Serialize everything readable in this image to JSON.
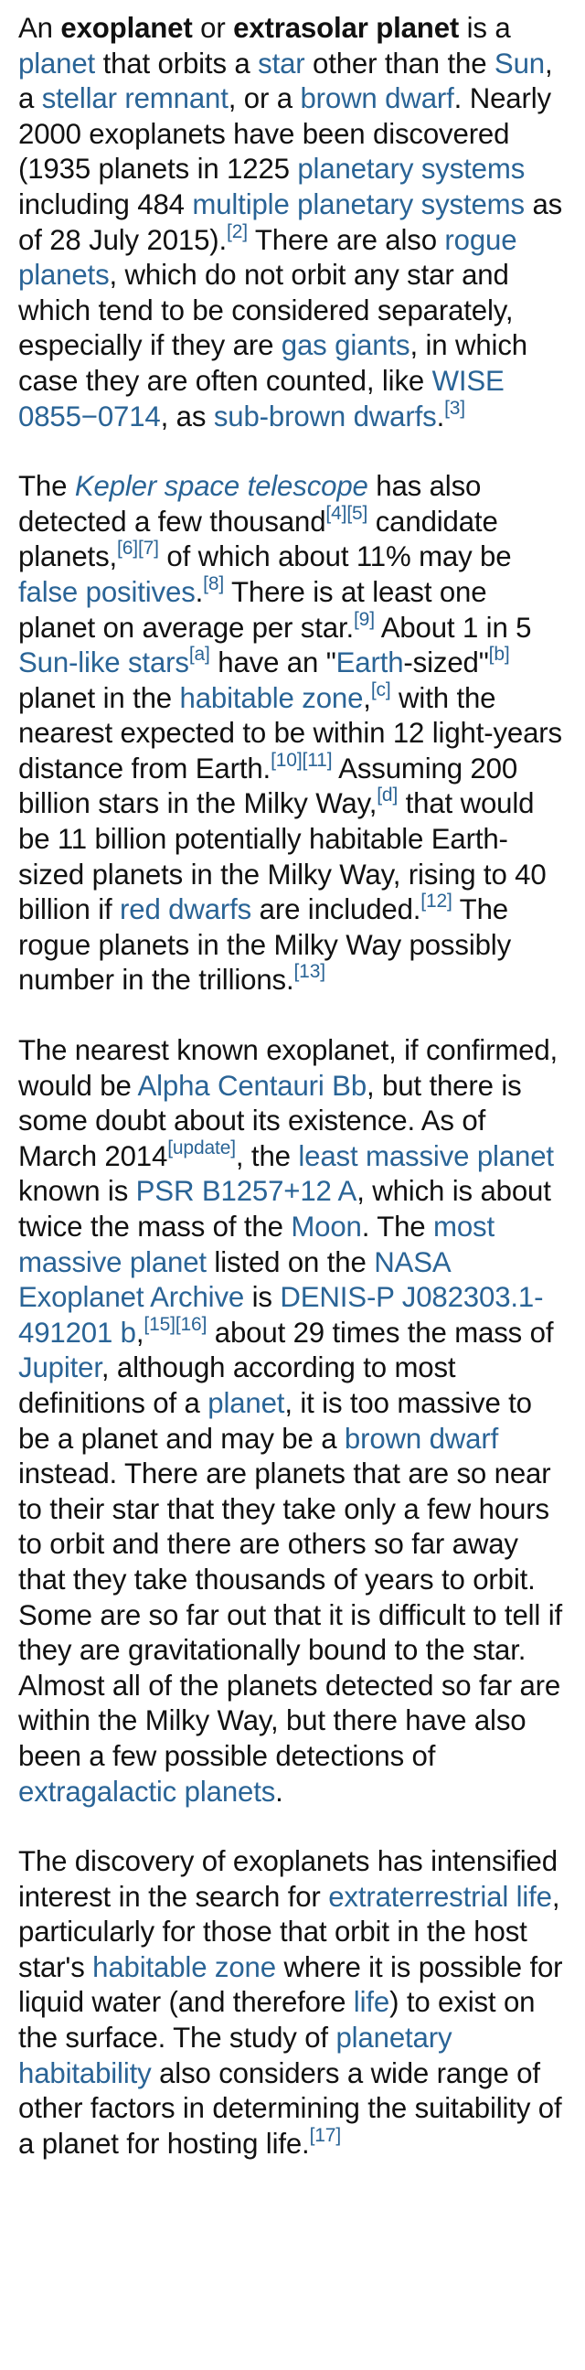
{
  "paragraphs": [
    [
      {
        "t": "text",
        "v": "An "
      },
      {
        "t": "bold",
        "v": "exoplanet"
      },
      {
        "t": "text",
        "v": " or "
      },
      {
        "t": "bold",
        "v": "extrasolar planet"
      },
      {
        "t": "text",
        "v": " is a "
      },
      {
        "t": "link",
        "v": "planet"
      },
      {
        "t": "text",
        "v": " that orbits a "
      },
      {
        "t": "link",
        "v": "star"
      },
      {
        "t": "text",
        "v": " other than the "
      },
      {
        "t": "link",
        "v": "Sun"
      },
      {
        "t": "text",
        "v": ", a "
      },
      {
        "t": "link",
        "v": "stellar remnant"
      },
      {
        "t": "text",
        "v": ", or a "
      },
      {
        "t": "link",
        "v": "brown dwarf"
      },
      {
        "t": "text",
        "v": ". Nearly 2000 exoplanets have been discovered (1935 planets in 1225 "
      },
      {
        "t": "link",
        "v": "planetary systems"
      },
      {
        "t": "text",
        "v": " including 484 "
      },
      {
        "t": "link",
        "v": "multiple planetary systems"
      },
      {
        "t": "text",
        "v": " as of 28 July 2015)."
      },
      {
        "t": "ref",
        "v": "[2]"
      },
      {
        "t": "text",
        "v": " There are also "
      },
      {
        "t": "link",
        "v": "rogue planets"
      },
      {
        "t": "text",
        "v": ", which do not orbit any star and which tend to be considered separately, especially if they are "
      },
      {
        "t": "link",
        "v": "gas giants"
      },
      {
        "t": "text",
        "v": ", in which case they are often counted, like "
      },
      {
        "t": "link",
        "v": "WISE 0855−0714"
      },
      {
        "t": "text",
        "v": ", as "
      },
      {
        "t": "link",
        "v": "sub-brown dwarfs"
      },
      {
        "t": "text",
        "v": "."
      },
      {
        "t": "ref",
        "v": "[3]"
      }
    ],
    [
      {
        "t": "text",
        "v": "The "
      },
      {
        "t": "ilink",
        "v": "Kepler space telescope"
      },
      {
        "t": "text",
        "v": " has also detected a few thousand"
      },
      {
        "t": "ref",
        "v": "[4]"
      },
      {
        "t": "ref",
        "v": "[5]"
      },
      {
        "t": "text",
        "v": " candidate planets,"
      },
      {
        "t": "ref",
        "v": "[6]"
      },
      {
        "t": "ref",
        "v": "[7]"
      },
      {
        "t": "text",
        "v": " of which about 11% may be "
      },
      {
        "t": "link",
        "v": "false positives"
      },
      {
        "t": "text",
        "v": "."
      },
      {
        "t": "ref",
        "v": "[8]"
      },
      {
        "t": "text",
        "v": " There is at least one planet on average per star."
      },
      {
        "t": "ref",
        "v": "[9]"
      },
      {
        "t": "text",
        "v": " About 1 in 5 "
      },
      {
        "t": "link",
        "v": "Sun-like stars"
      },
      {
        "t": "ref",
        "v": "[a]"
      },
      {
        "t": "text",
        "v": " have an \""
      },
      {
        "t": "link",
        "v": "Earth"
      },
      {
        "t": "text",
        "v": "-sized\""
      },
      {
        "t": "ref",
        "v": "[b]"
      },
      {
        "t": "text",
        "v": " planet in the "
      },
      {
        "t": "link",
        "v": "habitable zone"
      },
      {
        "t": "text",
        "v": ","
      },
      {
        "t": "ref",
        "v": "[c]"
      },
      {
        "t": "text",
        "v": " with the nearest expected to be within 12 light-years distance from Earth."
      },
      {
        "t": "ref",
        "v": "[10]"
      },
      {
        "t": "ref",
        "v": "[11]"
      },
      {
        "t": "text",
        "v": " Assuming 200 billion stars in the Milky Way,"
      },
      {
        "t": "ref",
        "v": "[d]"
      },
      {
        "t": "text",
        "v": " that would be 11 billion potentially habitable Earth-sized planets in the Milky Way, rising to 40 billion if "
      },
      {
        "t": "link",
        "v": "red dwarfs"
      },
      {
        "t": "text",
        "v": " are included."
      },
      {
        "t": "ref",
        "v": "[12]"
      },
      {
        "t": "text",
        "v": " The rogue planets in the Milky Way possibly number in the trillions."
      },
      {
        "t": "ref",
        "v": "[13]"
      }
    ],
    [
      {
        "t": "text",
        "v": "The nearest known exoplanet, if confirmed, would be "
      },
      {
        "t": "link",
        "v": "Alpha Centauri Bb"
      },
      {
        "t": "text",
        "v": ", but there is some doubt about its existence. As of March 2014"
      },
      {
        "t": "ref",
        "v": "[update]"
      },
      {
        "t": "text",
        "v": ", the "
      },
      {
        "t": "link",
        "v": "least massive planet"
      },
      {
        "t": "text",
        "v": " known is "
      },
      {
        "t": "link",
        "v": "PSR B1257+12 A"
      },
      {
        "t": "text",
        "v": ", which is about twice the mass of the "
      },
      {
        "t": "link",
        "v": "Moon"
      },
      {
        "t": "text",
        "v": ". The "
      },
      {
        "t": "link",
        "v": "most massive planet"
      },
      {
        "t": "text",
        "v": " listed on the "
      },
      {
        "t": "link",
        "v": "NASA Exoplanet Archive"
      },
      {
        "t": "text",
        "v": " is "
      },
      {
        "t": "link",
        "v": "DENIS-P J082303.1-491201 b"
      },
      {
        "t": "text",
        "v": ","
      },
      {
        "t": "ref",
        "v": "[15]"
      },
      {
        "t": "ref",
        "v": "[16]"
      },
      {
        "t": "text",
        "v": " about 29 times the mass of "
      },
      {
        "t": "link",
        "v": "Jupiter"
      },
      {
        "t": "text",
        "v": ", although according to most definitions of a "
      },
      {
        "t": "link",
        "v": "planet"
      },
      {
        "t": "text",
        "v": ", it is too massive to be a planet and may be a "
      },
      {
        "t": "link",
        "v": "brown dwarf"
      },
      {
        "t": "text",
        "v": " instead. There are planets that are so near to their star that they take only a few hours to orbit and there are others so far away that they take thousands of years to orbit. Some are so far out that it is difficult to tell if they are gravitationally bound to the star. Almost all of the planets detected so far are within the Milky Way, but there have also been a few possible detections of "
      },
      {
        "t": "link",
        "v": "extragalactic planets"
      },
      {
        "t": "text",
        "v": "."
      }
    ],
    [
      {
        "t": "text",
        "v": "The discovery of exoplanets has intensified interest in the search for "
      },
      {
        "t": "link",
        "v": "extraterrestrial life"
      },
      {
        "t": "text",
        "v": ", particularly for those that orbit in the host star's "
      },
      {
        "t": "link",
        "v": "habitable zone"
      },
      {
        "t": "text",
        "v": " where it is possible for liquid water (and therefore "
      },
      {
        "t": "link",
        "v": "life"
      },
      {
        "t": "text",
        "v": ") to exist on the surface. The study of "
      },
      {
        "t": "link",
        "v": "planetary habitability"
      },
      {
        "t": "text",
        "v": " also considers a wide range of other factors in determining the suitability of a planet for hosting life."
      },
      {
        "t": "ref",
        "v": "[17]"
      }
    ]
  ]
}
